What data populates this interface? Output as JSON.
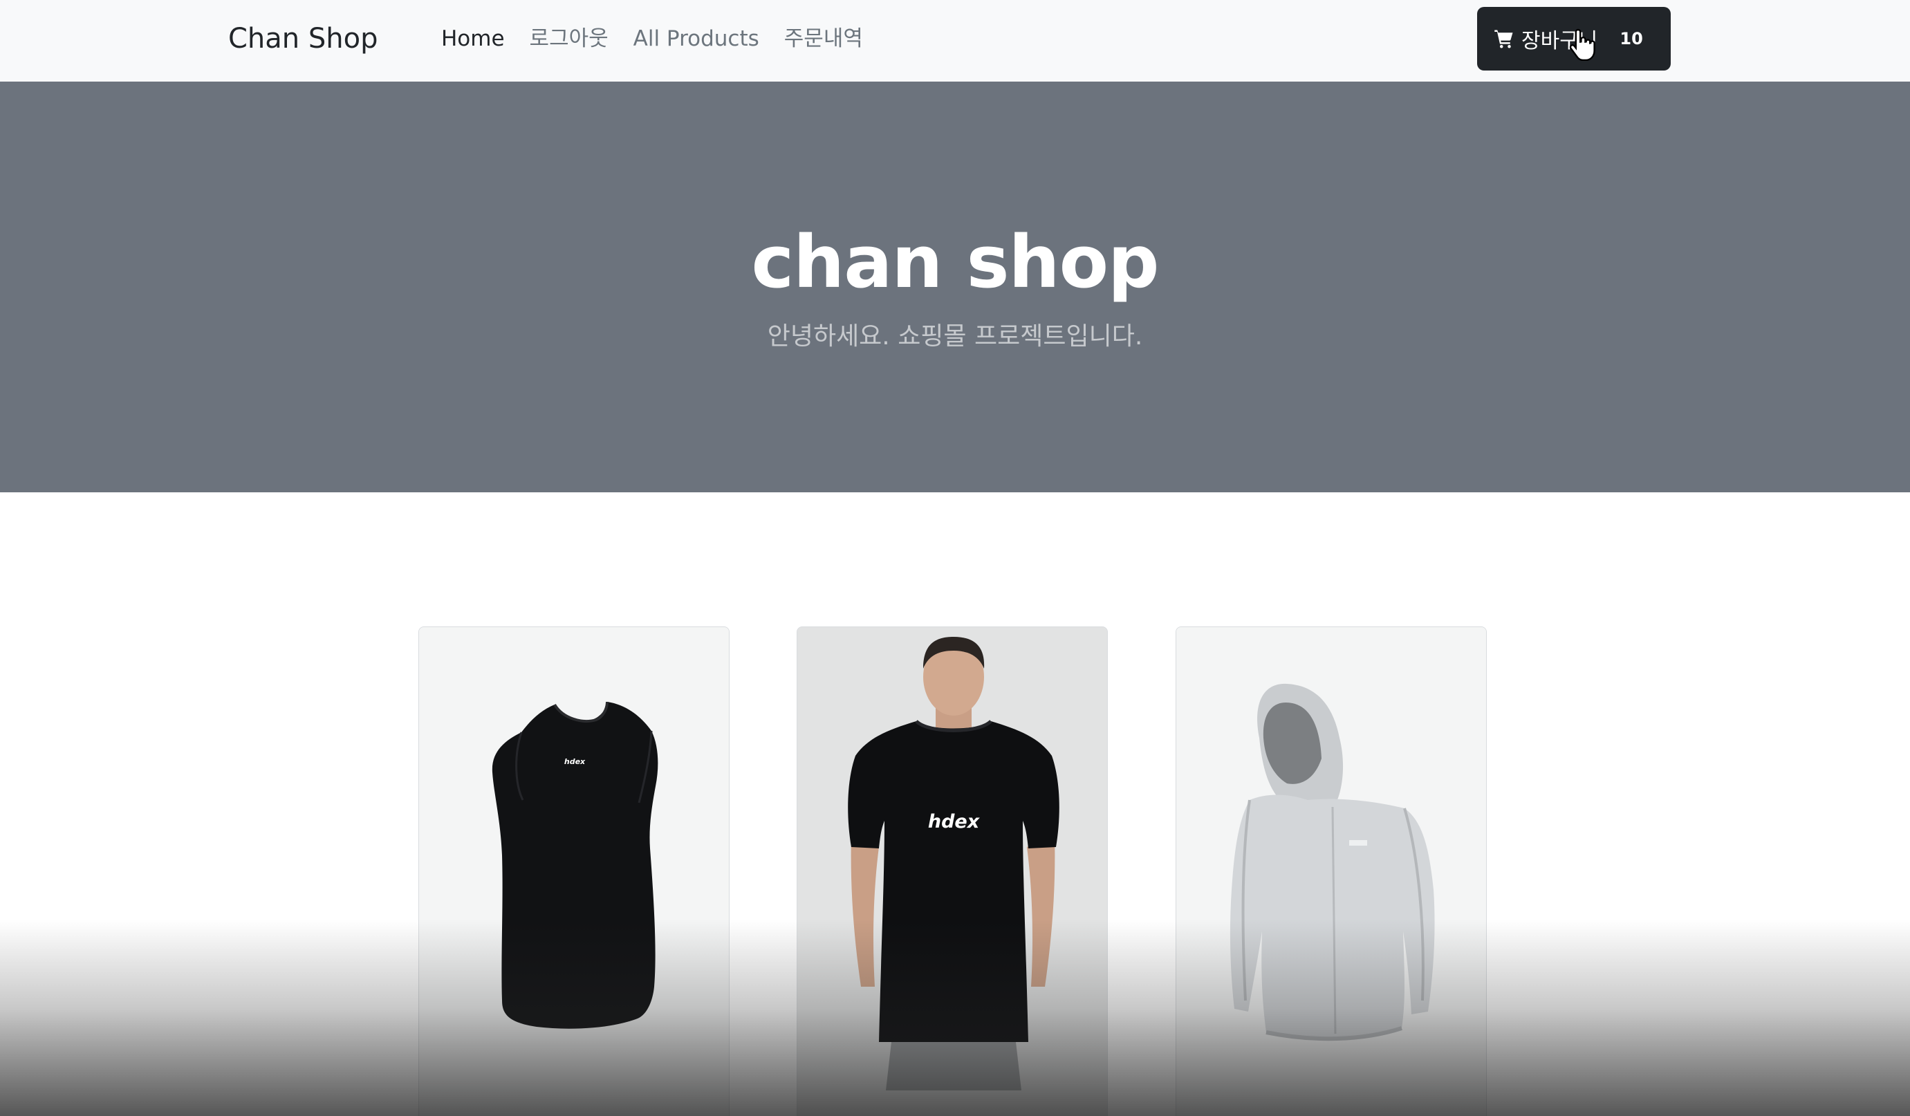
{
  "navbar": {
    "brand": "Chan Shop",
    "links": [
      {
        "label": "Home"
      },
      {
        "label": "로그아웃"
      },
      {
        "label": "All Products"
      },
      {
        "label": "주문내역"
      }
    ],
    "cart": {
      "label": "장바구니",
      "count": "10"
    }
  },
  "hero": {
    "title": "chan shop",
    "subtitle": "안녕하세요. 쇼핑몰 프로젝트입니다."
  },
  "products": [
    {
      "image": "black-sleeveless-tank-top",
      "logo": "hdex"
    },
    {
      "image": "model-in-black-tshirt",
      "logo": "hdex"
    },
    {
      "image": "grey-hooded-windbreaker-jacket"
    }
  ],
  "colors": {
    "navbar_bg": "#f8f9fa",
    "hero_bg": "#6c737d",
    "cart_button_bg": "#212529"
  }
}
